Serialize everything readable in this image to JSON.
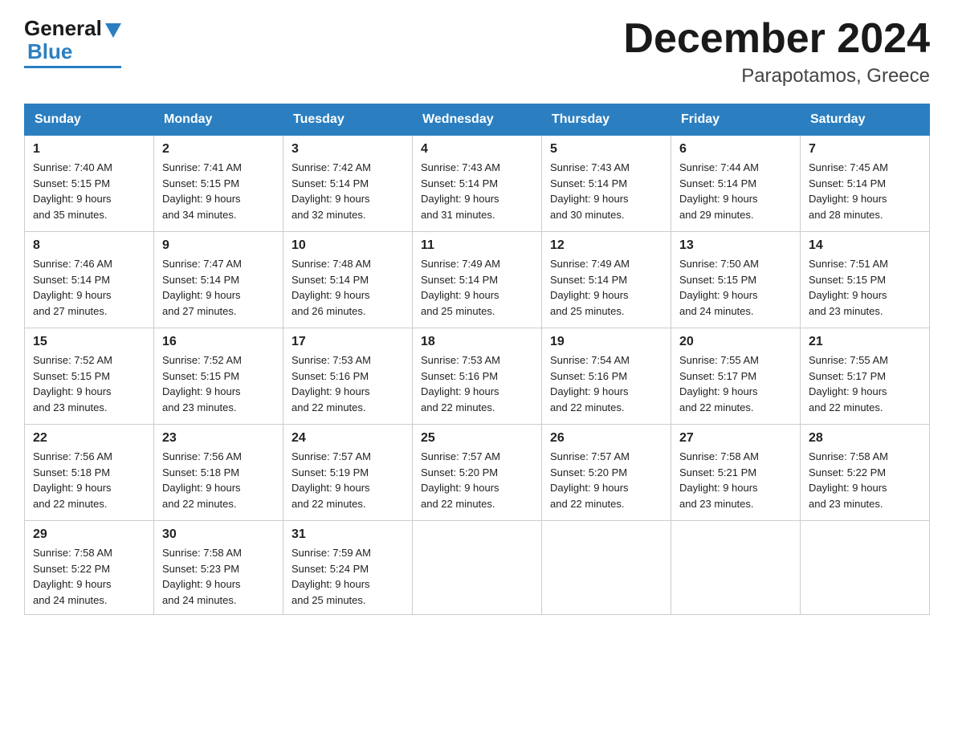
{
  "logo": {
    "general": "General",
    "blue": "Blue"
  },
  "title": "December 2024",
  "subtitle": "Parapotamos, Greece",
  "days_of_week": [
    "Sunday",
    "Monday",
    "Tuesday",
    "Wednesday",
    "Thursday",
    "Friday",
    "Saturday"
  ],
  "weeks": [
    [
      {
        "num": "1",
        "sunrise": "7:40 AM",
        "sunset": "5:15 PM",
        "daylight": "9 hours and 35 minutes."
      },
      {
        "num": "2",
        "sunrise": "7:41 AM",
        "sunset": "5:15 PM",
        "daylight": "9 hours and 34 minutes."
      },
      {
        "num": "3",
        "sunrise": "7:42 AM",
        "sunset": "5:14 PM",
        "daylight": "9 hours and 32 minutes."
      },
      {
        "num": "4",
        "sunrise": "7:43 AM",
        "sunset": "5:14 PM",
        "daylight": "9 hours and 31 minutes."
      },
      {
        "num": "5",
        "sunrise": "7:43 AM",
        "sunset": "5:14 PM",
        "daylight": "9 hours and 30 minutes."
      },
      {
        "num": "6",
        "sunrise": "7:44 AM",
        "sunset": "5:14 PM",
        "daylight": "9 hours and 29 minutes."
      },
      {
        "num": "7",
        "sunrise": "7:45 AM",
        "sunset": "5:14 PM",
        "daylight": "9 hours and 28 minutes."
      }
    ],
    [
      {
        "num": "8",
        "sunrise": "7:46 AM",
        "sunset": "5:14 PM",
        "daylight": "9 hours and 27 minutes."
      },
      {
        "num": "9",
        "sunrise": "7:47 AM",
        "sunset": "5:14 PM",
        "daylight": "9 hours and 27 minutes."
      },
      {
        "num": "10",
        "sunrise": "7:48 AM",
        "sunset": "5:14 PM",
        "daylight": "9 hours and 26 minutes."
      },
      {
        "num": "11",
        "sunrise": "7:49 AM",
        "sunset": "5:14 PM",
        "daylight": "9 hours and 25 minutes."
      },
      {
        "num": "12",
        "sunrise": "7:49 AM",
        "sunset": "5:14 PM",
        "daylight": "9 hours and 25 minutes."
      },
      {
        "num": "13",
        "sunrise": "7:50 AM",
        "sunset": "5:15 PM",
        "daylight": "9 hours and 24 minutes."
      },
      {
        "num": "14",
        "sunrise": "7:51 AM",
        "sunset": "5:15 PM",
        "daylight": "9 hours and 23 minutes."
      }
    ],
    [
      {
        "num": "15",
        "sunrise": "7:52 AM",
        "sunset": "5:15 PM",
        "daylight": "9 hours and 23 minutes."
      },
      {
        "num": "16",
        "sunrise": "7:52 AM",
        "sunset": "5:15 PM",
        "daylight": "9 hours and 23 minutes."
      },
      {
        "num": "17",
        "sunrise": "7:53 AM",
        "sunset": "5:16 PM",
        "daylight": "9 hours and 22 minutes."
      },
      {
        "num": "18",
        "sunrise": "7:53 AM",
        "sunset": "5:16 PM",
        "daylight": "9 hours and 22 minutes."
      },
      {
        "num": "19",
        "sunrise": "7:54 AM",
        "sunset": "5:16 PM",
        "daylight": "9 hours and 22 minutes."
      },
      {
        "num": "20",
        "sunrise": "7:55 AM",
        "sunset": "5:17 PM",
        "daylight": "9 hours and 22 minutes."
      },
      {
        "num": "21",
        "sunrise": "7:55 AM",
        "sunset": "5:17 PM",
        "daylight": "9 hours and 22 minutes."
      }
    ],
    [
      {
        "num": "22",
        "sunrise": "7:56 AM",
        "sunset": "5:18 PM",
        "daylight": "9 hours and 22 minutes."
      },
      {
        "num": "23",
        "sunrise": "7:56 AM",
        "sunset": "5:18 PM",
        "daylight": "9 hours and 22 minutes."
      },
      {
        "num": "24",
        "sunrise": "7:57 AM",
        "sunset": "5:19 PM",
        "daylight": "9 hours and 22 minutes."
      },
      {
        "num": "25",
        "sunrise": "7:57 AM",
        "sunset": "5:20 PM",
        "daylight": "9 hours and 22 minutes."
      },
      {
        "num": "26",
        "sunrise": "7:57 AM",
        "sunset": "5:20 PM",
        "daylight": "9 hours and 22 minutes."
      },
      {
        "num": "27",
        "sunrise": "7:58 AM",
        "sunset": "5:21 PM",
        "daylight": "9 hours and 23 minutes."
      },
      {
        "num": "28",
        "sunrise": "7:58 AM",
        "sunset": "5:22 PM",
        "daylight": "9 hours and 23 minutes."
      }
    ],
    [
      {
        "num": "29",
        "sunrise": "7:58 AM",
        "sunset": "5:22 PM",
        "daylight": "9 hours and 24 minutes."
      },
      {
        "num": "30",
        "sunrise": "7:58 AM",
        "sunset": "5:23 PM",
        "daylight": "9 hours and 24 minutes."
      },
      {
        "num": "31",
        "sunrise": "7:59 AM",
        "sunset": "5:24 PM",
        "daylight": "9 hours and 25 minutes."
      },
      null,
      null,
      null,
      null
    ]
  ]
}
